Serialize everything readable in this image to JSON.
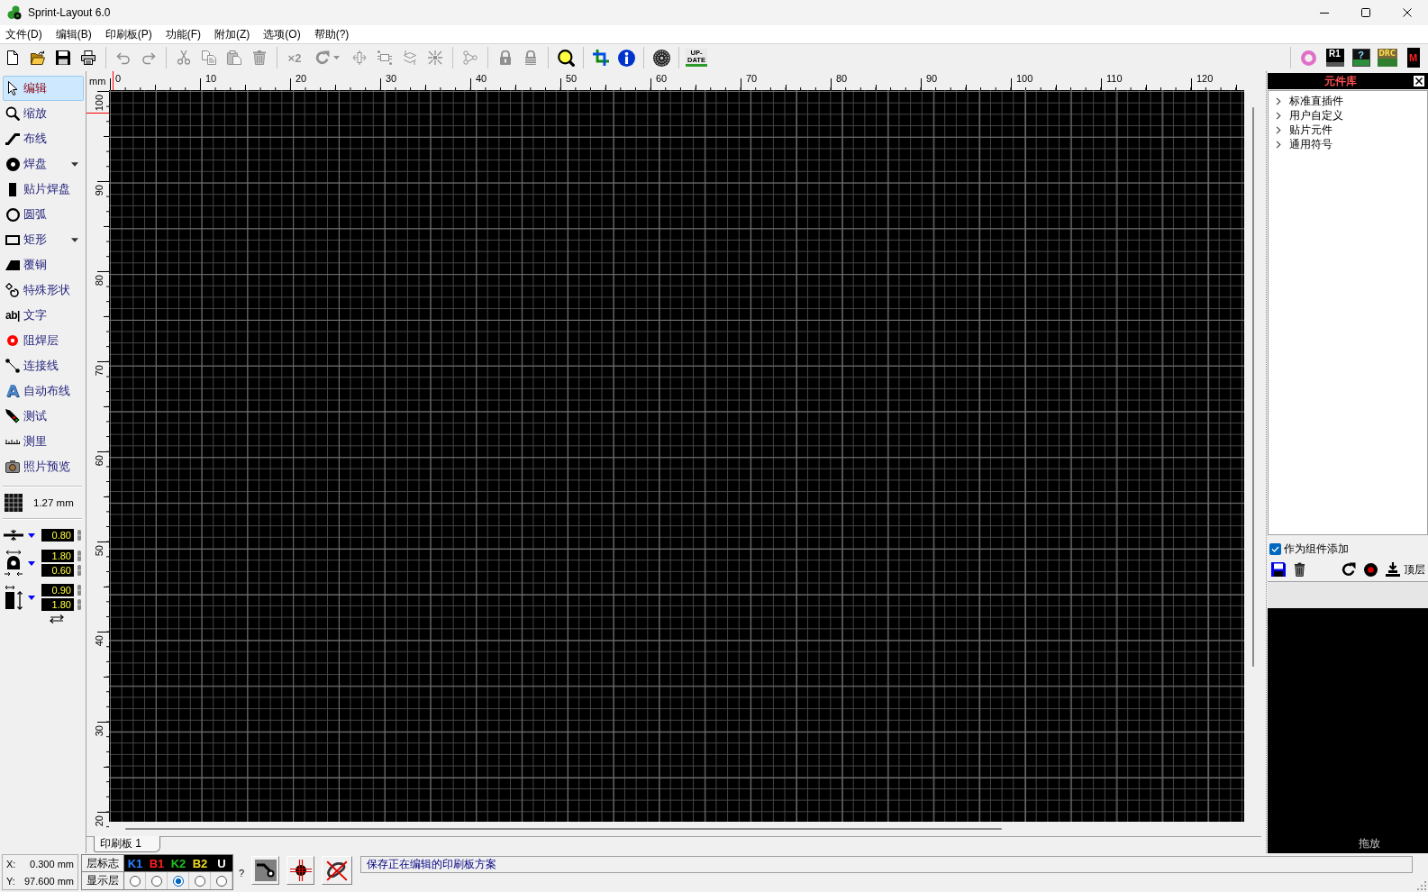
{
  "window": {
    "title": "Sprint-Layout 6.0"
  },
  "menu": [
    "文件(D)",
    "编辑(B)",
    "印刷板(P)",
    "功能(F)",
    "附加(Z)",
    "选项(O)",
    "帮助(?)"
  ],
  "toolbar": {
    "groups": [
      [
        {
          "disabled": false,
          "dropdown": false
        },
        {
          "disabled": false,
          "dropdown": false
        },
        {
          "disabled": false,
          "dropdown": false
        },
        {
          "disabled": false,
          "dropdown": false
        }
      ],
      [
        {
          "disabled": true,
          "dropdown": false
        },
        {
          "disabled": true,
          "dropdown": false
        }
      ],
      [
        {
          "disabled": true,
          "dropdown": false
        },
        {
          "disabled": true,
          "dropdown": false
        },
        {
          "disabled": true,
          "dropdown": false
        },
        {
          "disabled": true,
          "dropdown": false
        }
      ],
      [
        {
          "label": "×2",
          "disabled": true,
          "dropdown": false
        },
        {
          "disabled": true,
          "dropdown": true
        },
        {
          "disabled": true,
          "dropdown": false
        },
        {
          "disabled": true,
          "dropdown": false
        },
        {
          "disabled": true,
          "dropdown": false
        },
        {
          "disabled": true,
          "dropdown": false
        }
      ],
      [
        {
          "disabled": true,
          "dropdown": false
        }
      ],
      [
        {
          "disabled": true,
          "dropdown": false
        },
        {
          "disabled": true,
          "dropdown": false
        }
      ],
      [
        {
          "disabled": false,
          "dropdown": false
        }
      ],
      [
        {
          "disabled": false,
          "dropdown": false
        },
        {
          "disabled": false,
          "dropdown": false
        }
      ],
      [
        {
          "disabled": false,
          "dropdown": false
        }
      ],
      [
        {
          "label": "UP-DATE",
          "disabled": false,
          "dropdown": false
        }
      ]
    ],
    "right": [
      {
        "disabled": false,
        "dropdown": false
      },
      {
        "label": "R1",
        "disabled": false,
        "dropdown": false
      },
      {
        "label": "?",
        "disabled": false,
        "dropdown": false
      },
      {
        "label": "DRC",
        "disabled": false,
        "dropdown": false
      },
      {
        "label": "M",
        "disabled": false,
        "dropdown": false
      }
    ]
  },
  "sidebar": {
    "tools": [
      {
        "label": "编辑",
        "selected": true,
        "dropdown": false
      },
      {
        "label": "缩放",
        "selected": false,
        "dropdown": false
      },
      {
        "label": "布线",
        "selected": false,
        "dropdown": false
      },
      {
        "label": "焊盘",
        "selected": false,
        "dropdown": true
      },
      {
        "label": "贴片焊盘",
        "selected": false,
        "dropdown": false
      },
      {
        "label": "圆弧",
        "selected": false,
        "dropdown": false
      },
      {
        "label": "矩形",
        "selected": false,
        "dropdown": true
      },
      {
        "label": "覆铜",
        "selected": false,
        "dropdown": false
      },
      {
        "label": "特殊形状",
        "selected": false,
        "dropdown": false
      },
      {
        "label": "文字",
        "icon_text": "ab|",
        "selected": false,
        "dropdown": false
      },
      {
        "label": "阻焊层",
        "selected": false,
        "dropdown": false
      },
      {
        "label": "连接线",
        "selected": false,
        "dropdown": false
      },
      {
        "label": "自动布线",
        "icon_text": "A",
        "selected": false,
        "dropdown": false
      },
      {
        "label": "测试",
        "selected": false,
        "dropdown": false
      },
      {
        "label": "测里",
        "selected": false,
        "dropdown": false
      },
      {
        "label": "照片预览",
        "selected": false,
        "dropdown": false
      }
    ],
    "grid": "1.27 mm",
    "widths": [
      {
        "values": [
          "0.80"
        ]
      },
      {
        "values": [
          "1.80",
          "0.60"
        ]
      },
      {
        "values": [
          "0.90",
          "1.80"
        ]
      }
    ]
  },
  "editor": {
    "ruler_unit": "mm",
    "top_ruler": [
      "0",
      "10",
      "20",
      "30",
      "40",
      "50",
      "60",
      "70",
      "80",
      "90",
      "100",
      "110",
      "120"
    ],
    "left_ruler": [
      "100",
      "90",
      "80",
      "70",
      "60",
      "50",
      "40",
      "30",
      "20"
    ],
    "tabs": [
      {
        "label": "印刷板 1",
        "selected": true
      }
    ]
  },
  "library": {
    "title": "元件库",
    "items": [
      {
        "label": "标准直插件",
        "expanded": false
      },
      {
        "label": "用户自定义",
        "expanded": false
      },
      {
        "label": "贴片元件",
        "expanded": false
      },
      {
        "label": "通用符号",
        "expanded": false
      }
    ],
    "add_as_group": {
      "label": "作为组件添加",
      "checked": true
    },
    "layer": "顶层",
    "preview_hint": "拖放"
  },
  "status_bar": {
    "x_label": "X:",
    "x_value": "0.300 mm",
    "y_label": "Y:",
    "y_value": "97.600 mm",
    "layer_row_label": "层标志",
    "visible_row_label": "显示层",
    "layers": [
      {
        "label": "K1",
        "color": "#2a7fff",
        "selected": false
      },
      {
        "label": "B1",
        "color": "#ff2020",
        "selected": false
      },
      {
        "label": "K2",
        "color": "#20c020",
        "selected": true
      },
      {
        "label": "B2",
        "color": "#f0dc20",
        "selected": false
      },
      {
        "label": "U",
        "color": "#ffffff",
        "selected": false
      }
    ],
    "help": "?",
    "message": "保存正在编辑的印刷板方案"
  }
}
